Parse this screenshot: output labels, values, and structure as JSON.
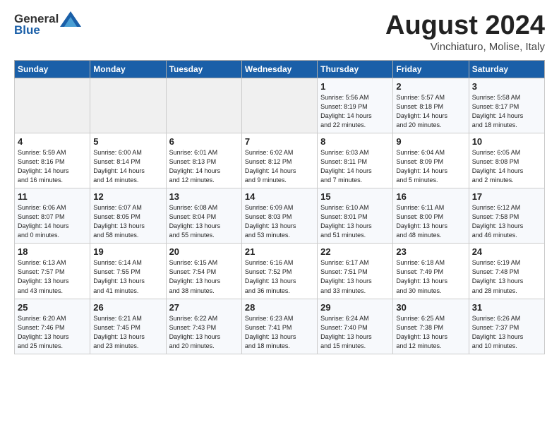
{
  "logo": {
    "line1": "General",
    "line2": "Blue"
  },
  "title": "August 2024",
  "subtitle": "Vinchiaturo, Molise, Italy",
  "days_header": [
    "Sunday",
    "Monday",
    "Tuesday",
    "Wednesday",
    "Thursday",
    "Friday",
    "Saturday"
  ],
  "weeks": [
    [
      {
        "day": "",
        "info": ""
      },
      {
        "day": "",
        "info": ""
      },
      {
        "day": "",
        "info": ""
      },
      {
        "day": "",
        "info": ""
      },
      {
        "day": "1",
        "info": "Sunrise: 5:56 AM\nSunset: 8:19 PM\nDaylight: 14 hours\nand 22 minutes."
      },
      {
        "day": "2",
        "info": "Sunrise: 5:57 AM\nSunset: 8:18 PM\nDaylight: 14 hours\nand 20 minutes."
      },
      {
        "day": "3",
        "info": "Sunrise: 5:58 AM\nSunset: 8:17 PM\nDaylight: 14 hours\nand 18 minutes."
      }
    ],
    [
      {
        "day": "4",
        "info": "Sunrise: 5:59 AM\nSunset: 8:16 PM\nDaylight: 14 hours\nand 16 minutes."
      },
      {
        "day": "5",
        "info": "Sunrise: 6:00 AM\nSunset: 8:14 PM\nDaylight: 14 hours\nand 14 minutes."
      },
      {
        "day": "6",
        "info": "Sunrise: 6:01 AM\nSunset: 8:13 PM\nDaylight: 14 hours\nand 12 minutes."
      },
      {
        "day": "7",
        "info": "Sunrise: 6:02 AM\nSunset: 8:12 PM\nDaylight: 14 hours\nand 9 minutes."
      },
      {
        "day": "8",
        "info": "Sunrise: 6:03 AM\nSunset: 8:11 PM\nDaylight: 14 hours\nand 7 minutes."
      },
      {
        "day": "9",
        "info": "Sunrise: 6:04 AM\nSunset: 8:09 PM\nDaylight: 14 hours\nand 5 minutes."
      },
      {
        "day": "10",
        "info": "Sunrise: 6:05 AM\nSunset: 8:08 PM\nDaylight: 14 hours\nand 2 minutes."
      }
    ],
    [
      {
        "day": "11",
        "info": "Sunrise: 6:06 AM\nSunset: 8:07 PM\nDaylight: 14 hours\nand 0 minutes."
      },
      {
        "day": "12",
        "info": "Sunrise: 6:07 AM\nSunset: 8:05 PM\nDaylight: 13 hours\nand 58 minutes."
      },
      {
        "day": "13",
        "info": "Sunrise: 6:08 AM\nSunset: 8:04 PM\nDaylight: 13 hours\nand 55 minutes."
      },
      {
        "day": "14",
        "info": "Sunrise: 6:09 AM\nSunset: 8:03 PM\nDaylight: 13 hours\nand 53 minutes."
      },
      {
        "day": "15",
        "info": "Sunrise: 6:10 AM\nSunset: 8:01 PM\nDaylight: 13 hours\nand 51 minutes."
      },
      {
        "day": "16",
        "info": "Sunrise: 6:11 AM\nSunset: 8:00 PM\nDaylight: 13 hours\nand 48 minutes."
      },
      {
        "day": "17",
        "info": "Sunrise: 6:12 AM\nSunset: 7:58 PM\nDaylight: 13 hours\nand 46 minutes."
      }
    ],
    [
      {
        "day": "18",
        "info": "Sunrise: 6:13 AM\nSunset: 7:57 PM\nDaylight: 13 hours\nand 43 minutes."
      },
      {
        "day": "19",
        "info": "Sunrise: 6:14 AM\nSunset: 7:55 PM\nDaylight: 13 hours\nand 41 minutes."
      },
      {
        "day": "20",
        "info": "Sunrise: 6:15 AM\nSunset: 7:54 PM\nDaylight: 13 hours\nand 38 minutes."
      },
      {
        "day": "21",
        "info": "Sunrise: 6:16 AM\nSunset: 7:52 PM\nDaylight: 13 hours\nand 36 minutes."
      },
      {
        "day": "22",
        "info": "Sunrise: 6:17 AM\nSunset: 7:51 PM\nDaylight: 13 hours\nand 33 minutes."
      },
      {
        "day": "23",
        "info": "Sunrise: 6:18 AM\nSunset: 7:49 PM\nDaylight: 13 hours\nand 30 minutes."
      },
      {
        "day": "24",
        "info": "Sunrise: 6:19 AM\nSunset: 7:48 PM\nDaylight: 13 hours\nand 28 minutes."
      }
    ],
    [
      {
        "day": "25",
        "info": "Sunrise: 6:20 AM\nSunset: 7:46 PM\nDaylight: 13 hours\nand 25 minutes."
      },
      {
        "day": "26",
        "info": "Sunrise: 6:21 AM\nSunset: 7:45 PM\nDaylight: 13 hours\nand 23 minutes."
      },
      {
        "day": "27",
        "info": "Sunrise: 6:22 AM\nSunset: 7:43 PM\nDaylight: 13 hours\nand 20 minutes."
      },
      {
        "day": "28",
        "info": "Sunrise: 6:23 AM\nSunset: 7:41 PM\nDaylight: 13 hours\nand 18 minutes."
      },
      {
        "day": "29",
        "info": "Sunrise: 6:24 AM\nSunset: 7:40 PM\nDaylight: 13 hours\nand 15 minutes."
      },
      {
        "day": "30",
        "info": "Sunrise: 6:25 AM\nSunset: 7:38 PM\nDaylight: 13 hours\nand 12 minutes."
      },
      {
        "day": "31",
        "info": "Sunrise: 6:26 AM\nSunset: 7:37 PM\nDaylight: 13 hours\nand 10 minutes."
      }
    ]
  ]
}
